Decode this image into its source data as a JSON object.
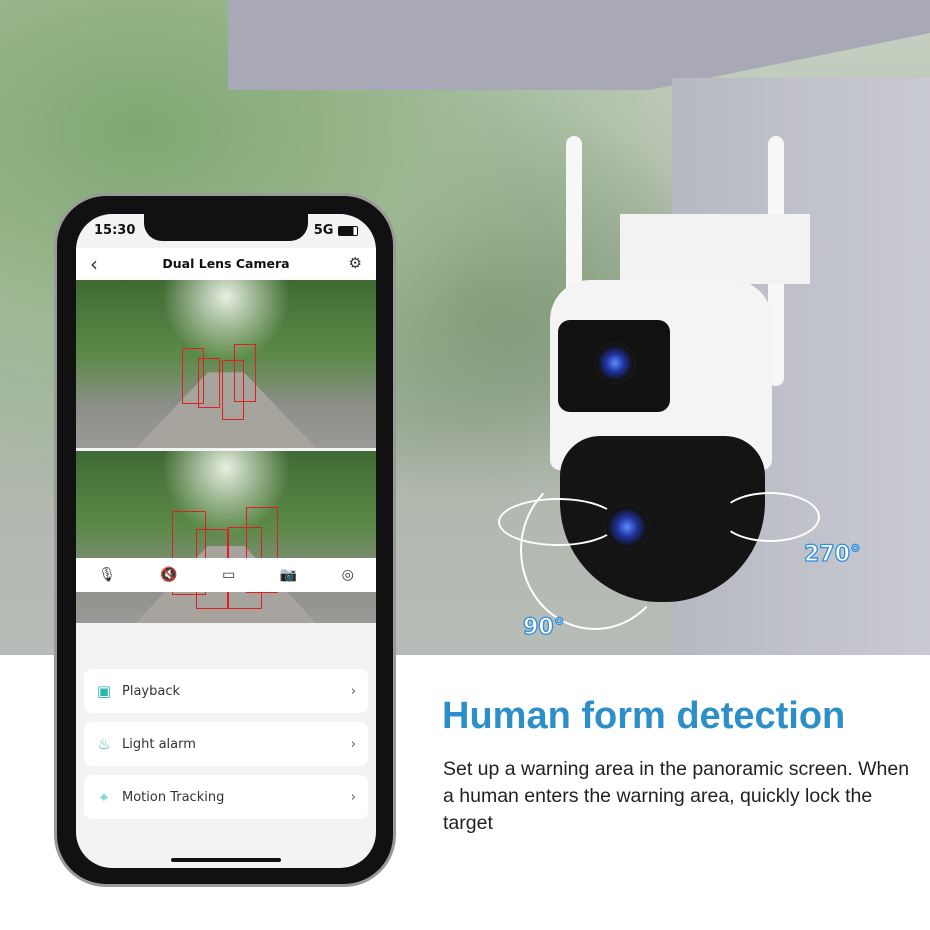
{
  "phone": {
    "status_time": "15:30",
    "network": "5G",
    "title": "Dual Lens Camera",
    "icons": {
      "back": "chevron-left-icon",
      "settings": "gear-icon"
    },
    "controls": [
      {
        "icon": "microphone-icon",
        "glyph": "🎙"
      },
      {
        "icon": "mute-icon",
        "glyph": "🔇"
      },
      {
        "icon": "record-icon",
        "glyph": "▭"
      },
      {
        "icon": "camera-icon",
        "glyph": "📷"
      },
      {
        "icon": "ptz-control-icon",
        "glyph": "◎"
      }
    ],
    "menu": [
      {
        "label": "Playback",
        "icon": "playback-icon",
        "glyph": "▣"
      },
      {
        "label": "Light alarm",
        "icon": "alarm-light-icon",
        "glyph": "♨"
      },
      {
        "label": "Motion Tracking",
        "icon": "crosshair-icon",
        "glyph": "⌖"
      }
    ]
  },
  "rotation": {
    "vertical": "90°",
    "horizontal": "270°"
  },
  "headline": "Human form detection",
  "description": "Set up a warning area in the panoramic screen. When a human enters the warning area, quickly lock the target",
  "colors": {
    "accent": "#2d8fc9",
    "detection_box": "#e02020",
    "menu_icon": "#2cb7a8"
  }
}
